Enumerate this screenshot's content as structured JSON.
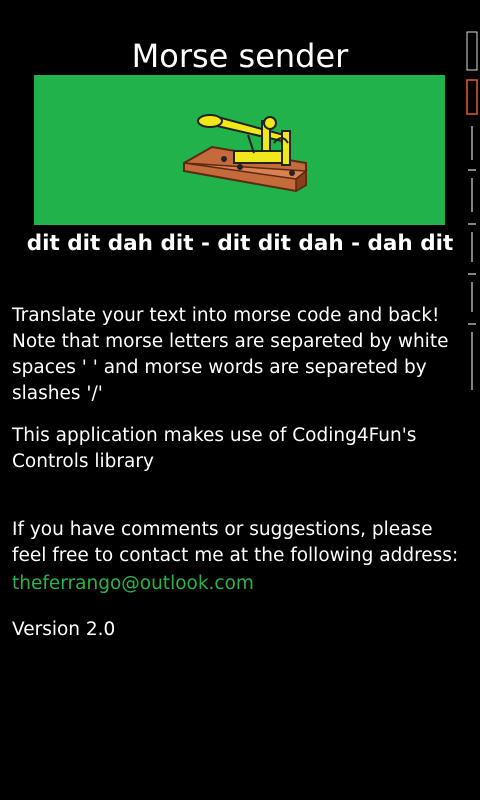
{
  "app": {
    "title": "Morse sender"
  },
  "banner": {
    "image": "telegraph-key-icon",
    "background": "#22b24c"
  },
  "morse_line": "dit dit dah dit - dit dit dah - dah dit",
  "about": {
    "description": "Translate your text into morse code and back! Note that morse letters are separeted by white spaces ' ' and morse words are separeted by slashes '/'",
    "library_note": "This application makes use of Coding4Fun's Controls library",
    "contact_text": "If you have comments or suggestions, please feel free to contact me at the following address:",
    "email": "theferrango@outlook.com",
    "version": "Version 2.0"
  },
  "colors": {
    "accent": "#2fb24a",
    "background": "#000000",
    "text": "#ffffff"
  }
}
